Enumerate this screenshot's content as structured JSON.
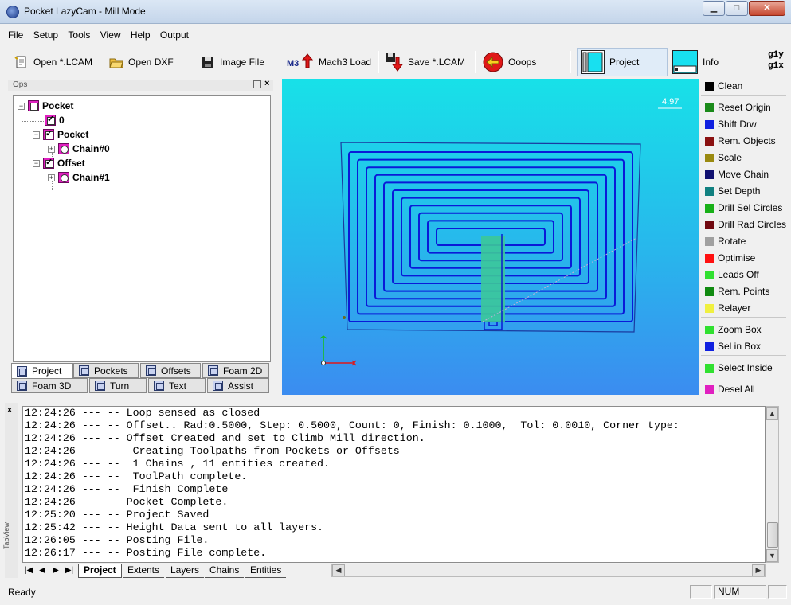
{
  "window": {
    "title": "Pocket LazyCam - Mill Mode",
    "min": "▁",
    "max": "□",
    "close": "✕"
  },
  "menu": [
    "File",
    "Setup",
    "Tools",
    "View",
    "Help",
    "Output"
  ],
  "toolbar": {
    "open_lcam": "Open *.LCAM",
    "open_dxf": "Open DXF",
    "image_file": "Image File",
    "mach3_load": "Mach3 Load",
    "mach3_icon_text": "M3",
    "save_lcam": "Save *.LCAM",
    "ooops": "Ooops",
    "project": "Project",
    "info": "Info",
    "gcode_line1": "g1y",
    "gcode_line2": "g1x"
  },
  "ops": {
    "title": "Ops",
    "tree": [
      {
        "label": "Pocket"
      },
      {
        "label": "0"
      },
      {
        "label": "Pocket"
      },
      {
        "label": "Chain#0"
      },
      {
        "label": "Offset"
      },
      {
        "label": "Chain#1"
      }
    ],
    "tabs_row1": [
      "Project",
      "Pockets",
      "Offsets",
      "Foam 2D"
    ],
    "tabs_row2": [
      "Foam 3D",
      "Turn",
      "Text",
      "Assist"
    ]
  },
  "viewport": {
    "scale_label": "4.97"
  },
  "right_panel": [
    {
      "label": "Clean",
      "color": "#000000"
    },
    {
      "label": "Reset Origin",
      "color": "#1a8a1a"
    },
    {
      "label": "Shift Drw",
      "color": "#1020e0"
    },
    {
      "label": "Rem. Objects",
      "color": "#8a1010"
    },
    {
      "label": "Scale",
      "color": "#9a8a10"
    },
    {
      "label": "Move Chain",
      "color": "#101070"
    },
    {
      "label": "Set Depth",
      "color": "#108080"
    },
    {
      "label": "Drill Sel Circles",
      "color": "#18b018"
    },
    {
      "label": "Drill Rad Circles",
      "color": "#700810"
    },
    {
      "label": "Rotate",
      "color": "#a0a0a0"
    },
    {
      "label": "Optimise",
      "color": "#ff1010"
    },
    {
      "label": "Leads Off",
      "color": "#30e030"
    },
    {
      "label": "Rem. Points",
      "color": "#108a10"
    },
    {
      "label": "Relayer",
      "color": "#f0f040"
    },
    {
      "label": "Zoom Box",
      "color": "#30e030"
    },
    {
      "label": "Sel in Box",
      "color": "#1020e0"
    },
    {
      "label": "Select Inside",
      "color": "#30e030"
    },
    {
      "label": "Desel All",
      "color": "#e020c0"
    }
  ],
  "log": {
    "side_label": "TabView",
    "close": "x",
    "lines": [
      "12:24:26 --- -- Loop sensed as closed",
      "12:24:26 --- -- Offset.. Rad:0.5000, Step: 0.5000, Count: 0, Finish: 0.1000,  Tol: 0.0010, Corner type:",
      "12:24:26 --- -- Offset Created and set to Climb Mill direction.",
      "12:24:26 --- --  Creating Toolpaths from Pockets or Offsets",
      "12:24:26 --- --  1 Chains , 11 entities created.",
      "12:24:26 --- --  ToolPath complete.",
      "12:24:26 --- --  Finish Complete",
      "12:24:26 --- -- Pocket Complete.",
      "12:25:20 --- -- Project Saved",
      "12:25:42 --- -- Height Data sent to all layers.",
      "12:26:05 --- -- Posting File.",
      "12:26:17 --- -- Posting File complete."
    ],
    "tabs": [
      "Project",
      "Extents",
      "Layers",
      "Chains",
      "Entities"
    ]
  },
  "status": {
    "text": "Ready",
    "num": "NUM"
  }
}
